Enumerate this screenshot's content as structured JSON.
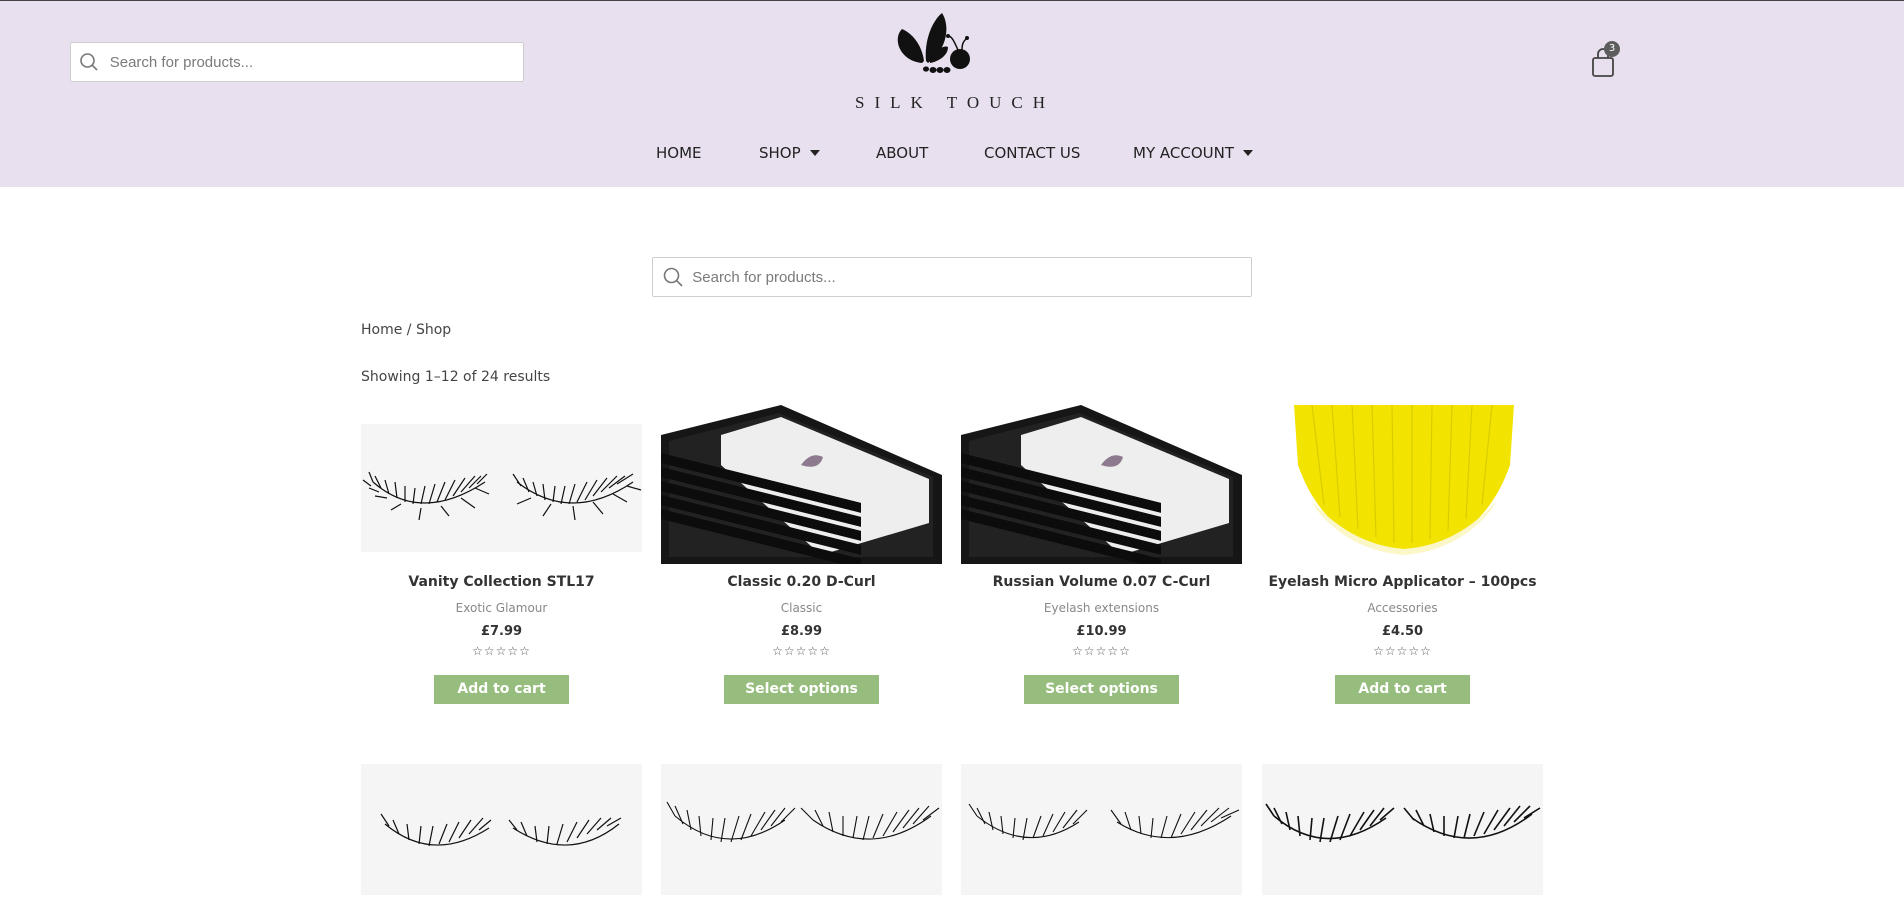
{
  "header": {
    "search_placeholder": "Search for products...",
    "logo_text": "SILK TOUCH",
    "cart_count": "3",
    "background": "#e8e0ef"
  },
  "nav": {
    "items": [
      {
        "label": "HOME",
        "has_dropdown": false
      },
      {
        "label": "SHOP",
        "has_dropdown": true
      },
      {
        "label": "ABOUT",
        "has_dropdown": false
      },
      {
        "label": "CONTACT US",
        "has_dropdown": false
      },
      {
        "label": "MY ACCOUNT",
        "has_dropdown": true
      }
    ]
  },
  "main": {
    "search_placeholder": "Search for products...",
    "breadcrumb": {
      "home": "Home",
      "separator": " / ",
      "current": "Shop"
    },
    "result_count": "Showing 1–12 of 24 results"
  },
  "products": [
    {
      "title": "Vanity Collection STL17",
      "category": "Exotic Glamour",
      "price": "£7.99",
      "rating": "☆☆☆☆☆",
      "button": "Add to cart",
      "image": "strip-lashes"
    },
    {
      "title": "Classic 0.20 D-Curl",
      "category": "Classic",
      "price": "£8.99",
      "rating": "☆☆☆☆☆",
      "button": "Select options",
      "image": "lash-tray"
    },
    {
      "title": "Russian Volume 0.07 C-Curl",
      "category": "Eyelash extensions",
      "price": "£10.99",
      "rating": "☆☆☆☆☆",
      "button": "Select options",
      "image": "lash-tray"
    },
    {
      "title": "Eyelash Micro Applicator – 100pcs",
      "category": "Accessories",
      "price": "£4.50",
      "rating": "☆☆☆☆☆",
      "button": "Add to cart",
      "image": "yellow-applicators"
    }
  ],
  "second_row": [
    {
      "image": "strip-lashes"
    },
    {
      "image": "strip-lashes"
    },
    {
      "image": "strip-lashes"
    },
    {
      "image": "strip-lashes"
    }
  ],
  "colors": {
    "button": "#96bd7d",
    "accent_yellow": "#f2e400"
  }
}
